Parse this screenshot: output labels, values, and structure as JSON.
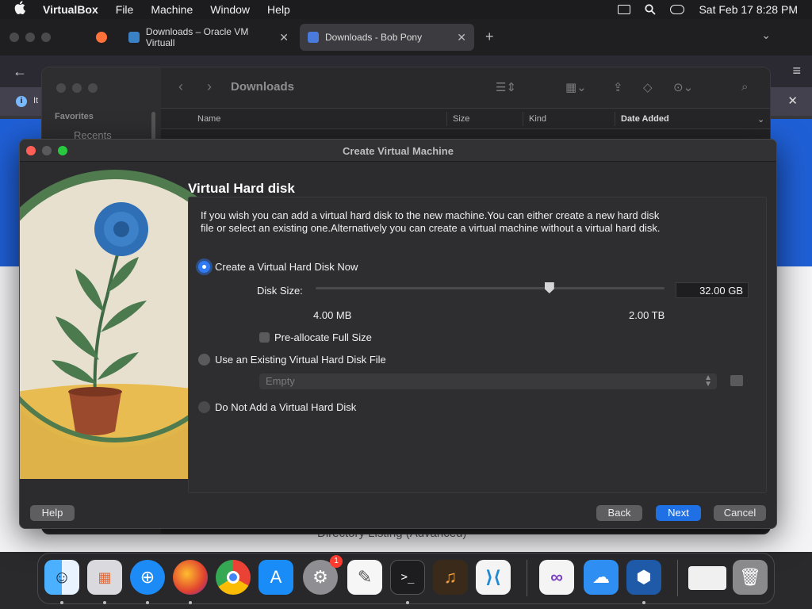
{
  "menubar": {
    "app_name": "VirtualBox",
    "menus": [
      "File",
      "Machine",
      "Window",
      "Help"
    ],
    "datetime": "Sat Feb 17  8:28 PM"
  },
  "browser": {
    "tabs": [
      {
        "label": "Downloads – Oracle VM Virtuall"
      },
      {
        "label": "Downloads - Bob Pony"
      }
    ],
    "infobar_text": "It",
    "page_footer_text": "Directory Listing (Advanced)"
  },
  "finder": {
    "title": "Downloads",
    "sidebar_heading": "Favorites",
    "sidebar_item": "Recents",
    "columns": [
      "Name",
      "Size",
      "Kind",
      "Date Added"
    ]
  },
  "dialog": {
    "title": "Create Virtual Machine",
    "heading": "Virtual Hard disk",
    "description": "If you wish you can add a virtual hard disk to the new machine.You can either create a new hard disk file or select an existing one.Alternatively you can create a virtual machine without a virtual hard disk.",
    "options": {
      "create_now": "Create a Virtual Hard Disk Now",
      "use_existing": "Use an Existing Virtual Hard Disk File",
      "do_not_add": "Do Not Add a Virtual Hard Disk"
    },
    "selected_option": "create_now",
    "disk_size_label": "Disk Size:",
    "disk_size_value": "32.00 GB",
    "disk_size_min": "4.00 MB",
    "disk_size_max": "2.00 TB",
    "slider_position": 0.67,
    "preallocate_label": "Pre-allocate Full Size",
    "preallocate_checked": false,
    "existing_file_value": "Empty",
    "buttons": {
      "help": "Help",
      "back": "Back",
      "next": "Next",
      "cancel": "Cancel"
    }
  },
  "dock": {
    "items": [
      "Finder",
      "Launchpad",
      "Safari",
      "Firefox",
      "Chrome",
      "App Store",
      "System Settings",
      "TextEdit",
      "Terminal",
      "GarageBand",
      "VS Code",
      "Visual Studio",
      "iCloud",
      "VirtualBox",
      "Preview",
      "Trash"
    ],
    "settings_badge": "1"
  },
  "colors": {
    "accent": "#1f6fe5",
    "radio_selected": "#2f7bf5",
    "traffic_red": "#ff5f57",
    "traffic_green": "#28c840"
  }
}
